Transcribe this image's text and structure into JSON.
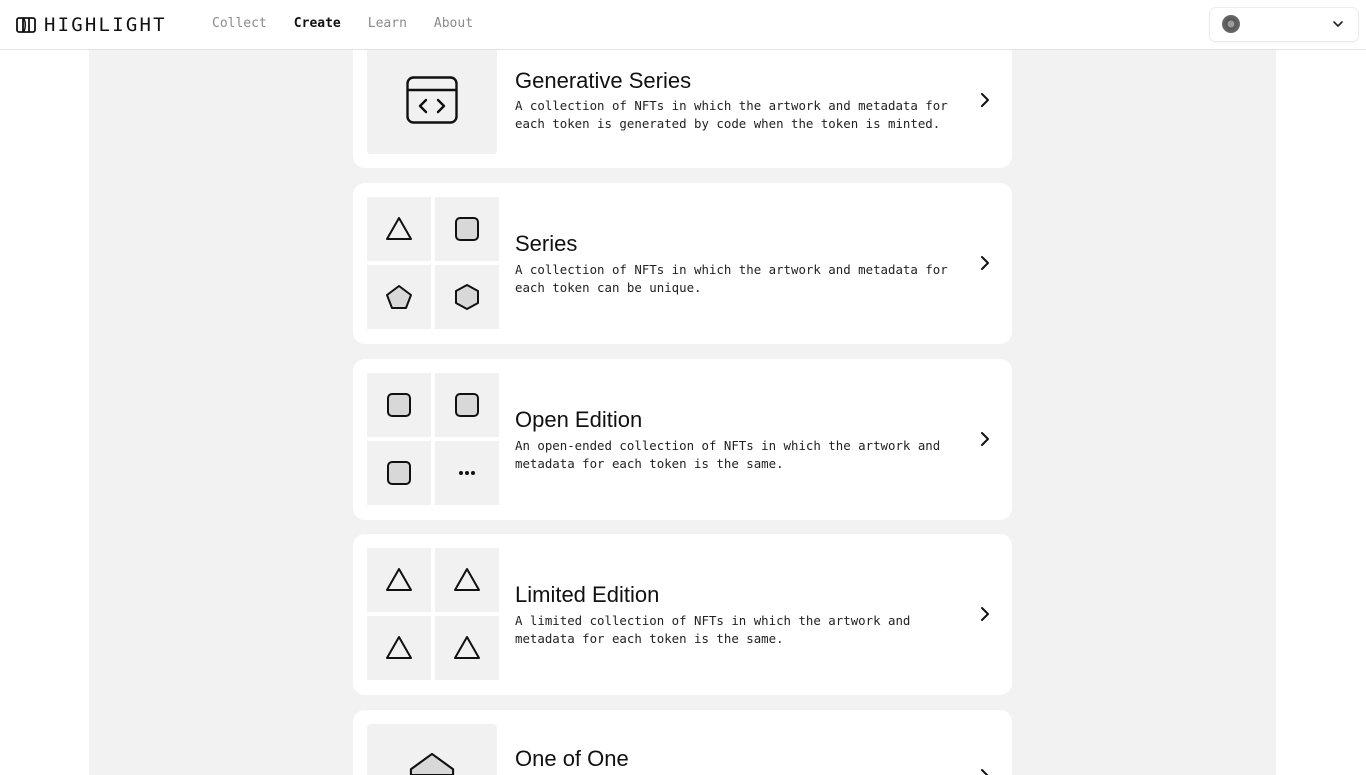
{
  "header": {
    "brand": "HIGHLIGHT",
    "nav": [
      {
        "label": "Collect",
        "active": false
      },
      {
        "label": "Create",
        "active": true
      },
      {
        "label": "Learn",
        "active": false
      },
      {
        "label": "About",
        "active": false
      }
    ]
  },
  "cards": [
    {
      "title": "Generative Series",
      "description": "A collection of NFTs in which the artwork and metadata for each token is generated by code when the token is minted.",
      "icon": "code-window-icon"
    },
    {
      "title": "Series",
      "description": "A collection of NFTs in which the artwork and metadata for each token can be unique.",
      "icon": "mixed-shapes-icon"
    },
    {
      "title": "Open Edition",
      "description": "An open-ended collection of NFTs in which the artwork and metadata for each token is the same.",
      "icon": "squares-and-ellipsis-icon"
    },
    {
      "title": "Limited Edition",
      "description": "A limited collection of NFTs in which the artwork and metadata for each token is the same.",
      "icon": "four-triangles-icon"
    },
    {
      "title": "One of One",
      "description": "",
      "icon": "pentagon-icon"
    }
  ],
  "colors": {
    "page_background": "#f2f2f2",
    "card_background": "#ffffff",
    "tile_background": "#f1f1f1",
    "text": "#111111",
    "nav_inactive": "#8a8a8a"
  }
}
